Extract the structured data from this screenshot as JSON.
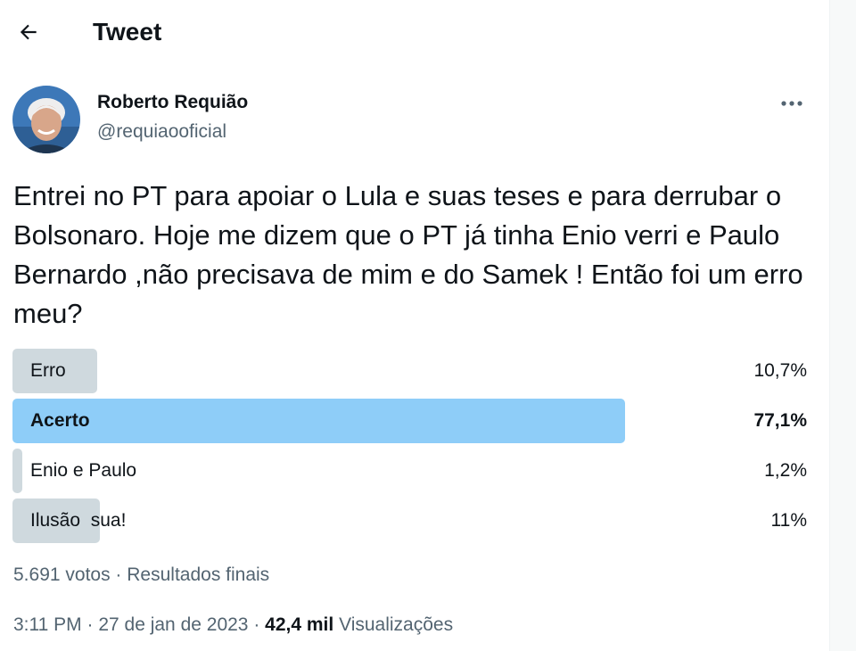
{
  "header": {
    "title": "Tweet",
    "back_icon": "arrow-left-icon"
  },
  "tweet": {
    "author": {
      "name": "Roberto Requião",
      "handle": "@requiaooficial",
      "avatar_icon": "avatar-photo"
    },
    "more_icon": "more-horizontal-icon",
    "text": "Entrei no PT para apoiar o Lula e suas teses e para derrubar o Bolsonaro. Hoje me dizem que o PT já tinha Enio verri e Paulo Bernardo ,não precisava de mim e do Samek ! Então foi um erro meu?",
    "poll": {
      "options": [
        {
          "label": "Erro",
          "percent_text": "10,7%",
          "percent": 10.7,
          "winner": false
        },
        {
          "label": "Acerto",
          "percent_text": "77,1%",
          "percent": 77.1,
          "winner": true
        },
        {
          "label": "Enio e Paulo",
          "percent_text": "1,2%",
          "percent": 1.2,
          "winner": false
        },
        {
          "label": "Ilusão  sua!",
          "percent_text": "11%",
          "percent": 11,
          "winner": false
        }
      ],
      "votes": "5.691 votos",
      "separator": " · ",
      "status": "Resultados finais",
      "colors": {
        "bar": "#cfd9de",
        "winner_bar": "#8ecdf8"
      }
    },
    "meta": {
      "time": "3:11 PM",
      "separator": " · ",
      "date": "27 de jan de 2023",
      "views_count": "42,4 mil",
      "views_label": "Visualizações"
    }
  }
}
